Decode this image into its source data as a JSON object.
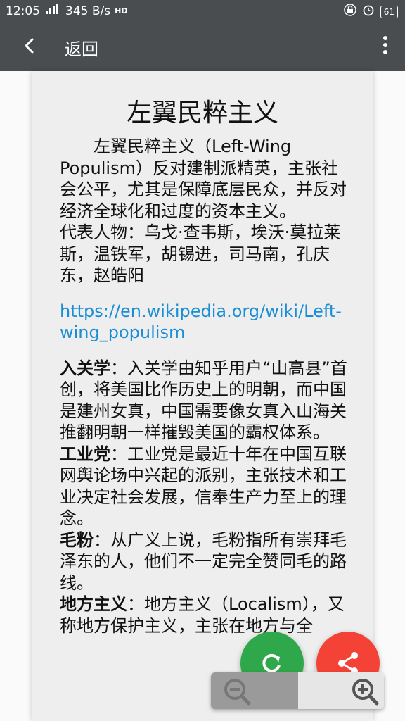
{
  "status_bar": {
    "time": "12:05",
    "network_speed": "345 B/s",
    "hd": "HD",
    "battery": "61"
  },
  "app_bar": {
    "back_label": "返回"
  },
  "article": {
    "title": "左翼民粹主义",
    "intro": "左翼民粹主义（Left-Wing Populism）反对建制派精英，主张社会公平，尤其是保障底层民众，并反对经济全球化和过度的资本主义。",
    "representatives": "代表人物：乌戈·查韦斯，埃沃·莫拉莱斯，温铁军，胡锡进，司马南，孔庆东，赵皓阳",
    "link": "https://en.wikipedia.org/wiki/Left-wing_populism",
    "sections": [
      {
        "term": "入关学",
        "sep": "：",
        "text": "入关学由知乎用户“山高县”首创，将美国比作历史上的明朝，而中国是建州女真，中国需要像女真入山海关推翻明朝一样摧毁美国的霸权体系。"
      },
      {
        "term": "工业党",
        "sep": "：",
        "text": "工业党是最近十年在中国互联网舆论场中兴起的派别，主张技术和工业决定社会发展，信奉生产力至上的理念。"
      },
      {
        "term": "毛粉",
        "sep": "：",
        "text": "从广义上说，毛粉指所有崇拜毛泽东的人，他们不一定完全赞同毛的路线。"
      },
      {
        "term": "地方主义",
        "sep": "：",
        "text": "地方主义（Localism），又称地方保护主义，主张在地方与全"
      }
    ]
  },
  "colors": {
    "app_bar": "#4a4d4f",
    "link": "#1a8fd6",
    "refresh_fab": "#2ea84a",
    "share_fab": "#f44336"
  }
}
